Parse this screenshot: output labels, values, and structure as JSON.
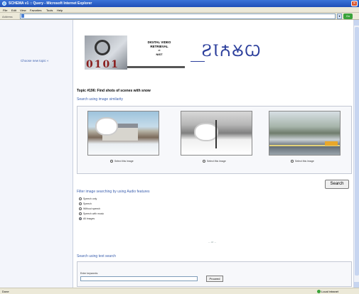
{
  "window": {
    "title": "SCHEMA v1 :: Query - Microsoft Internet Explorer",
    "close_glyph": "✕"
  },
  "menu": [
    "File",
    "Edit",
    "View",
    "Favorites",
    "Tools",
    "Help"
  ],
  "address": {
    "label": "Address",
    "url": "",
    "go_label": "Go"
  },
  "sidebar": {
    "change_topic": "Choose new topic  «"
  },
  "banner": {
    "digits": "0101",
    "line1": "DIGITAL VIDEO",
    "line2": "RETRIEVAL",
    "line3": "at",
    "org": "NIST",
    "logo": "ꙄꙆꙈꙊꙌ"
  },
  "topic": {
    "title": "Topic #196: Find shots of scenes with snow"
  },
  "image_search": {
    "heading": "Search using image similarity",
    "images": [
      {
        "name": "snowy-house",
        "select_label": "Select this image"
      },
      {
        "name": "snowy-yard",
        "select_label": "Select this image"
      },
      {
        "name": "snowy-road",
        "select_label": "Select this image"
      }
    ],
    "search_label": "Search"
  },
  "audio_filter": {
    "heading": "Filter image searching by using Audio features",
    "options": [
      {
        "label": "Speech only",
        "checked": false
      },
      {
        "label": "Speech",
        "checked": false
      },
      {
        "label": "Without speech",
        "checked": false
      },
      {
        "label": "Speech with music",
        "checked": false
      },
      {
        "label": "All images",
        "checked": true
      }
    ]
  },
  "center_marker": "-- or --",
  "text_search": {
    "heading": "Search using text search",
    "keywords_label": "Enter keywords:",
    "keywords_value": "",
    "proceed_label": "Proceed"
  },
  "status": {
    "text": "Done",
    "zone": "Local intranet"
  },
  "colors": {
    "titlebar": "#1f4fb8",
    "link": "#3b5fae",
    "logo": "#2c3f9c",
    "chrome": "#ece9d8"
  }
}
